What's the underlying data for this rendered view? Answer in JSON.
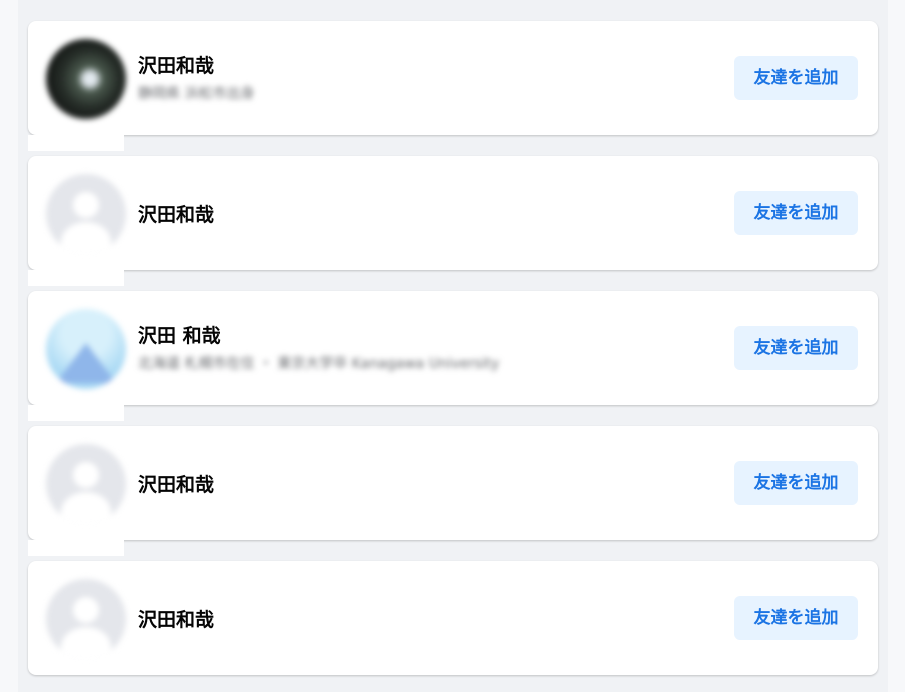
{
  "results": [
    {
      "name": "沢田和哉",
      "subline": "静岡県 浜松市出身",
      "avatar": "photo"
    },
    {
      "name": "沢田和哉",
      "subline": "",
      "avatar": "default"
    },
    {
      "name": "沢田 和哉",
      "subline": "北海道 札幌市在住 ・ 東京大学卒 Kanagawa University",
      "avatar": "mountain"
    },
    {
      "name": "沢田和哉",
      "subline": "",
      "avatar": "default"
    },
    {
      "name": "沢田和哉",
      "subline": "",
      "avatar": "default"
    }
  ],
  "add_friend_label": "友達を追加",
  "colors": {
    "page_bg": "#f0f2f5",
    "card_bg": "#ffffff",
    "button_bg": "#e7f3ff",
    "button_text": "#1b74e4",
    "name_text": "#050505"
  },
  "icons": {
    "default_avatar": "default-profile-silhouette-icon",
    "add_friend": "none"
  }
}
